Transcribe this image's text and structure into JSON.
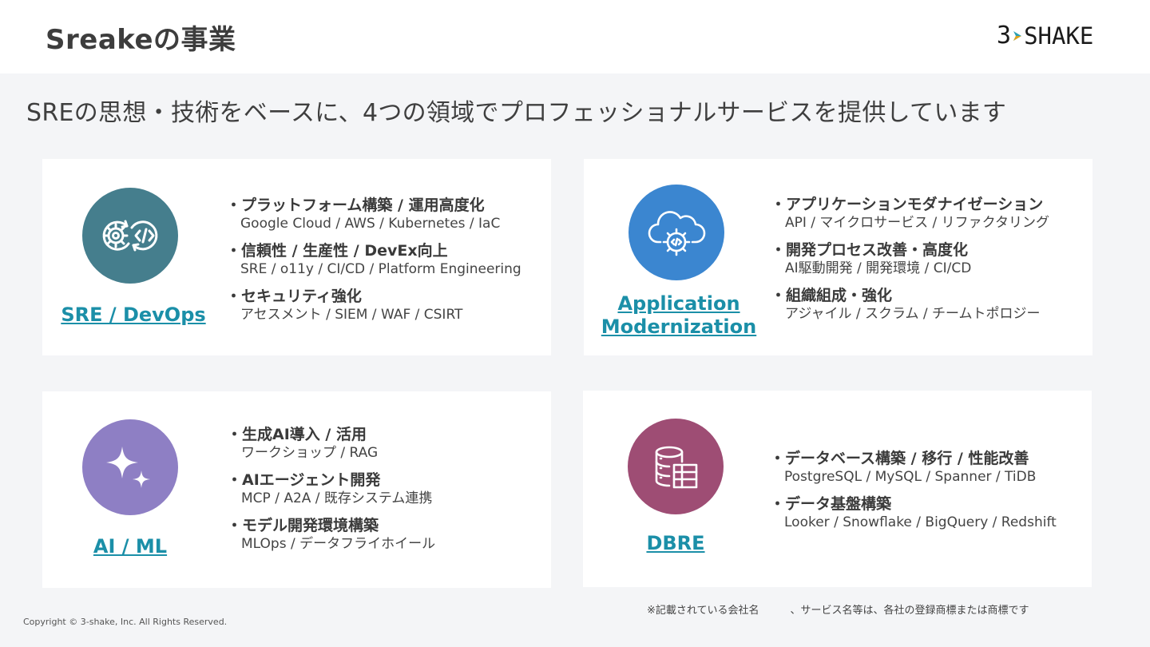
{
  "header": {
    "title": "Sreakeの事業",
    "logo_num": "3",
    "logo_text": "SHAKE"
  },
  "subtitle": "SREの思想・技術をベースに、4つの領域でプロフェッショナルサービスを提供しています",
  "colors": {
    "sre": "#457e8d",
    "app": "#3b86d0",
    "ai": "#8e7fc4",
    "dbre": "#9e4d74",
    "link": "#1b8fa8"
  },
  "cards": {
    "sre": {
      "name": "SRE / DevOps",
      "icon": "gear-code-cycle-icon",
      "bullets": [
        {
          "title": "・プラットフォーム構築 / 運用高度化",
          "sub": "Google Cloud / AWS / Kubernetes / IaC"
        },
        {
          "title": "・信頼性 / 生産性 / DevEx向上",
          "sub": "SRE / o11y / CI/CD / Platform Engineering"
        },
        {
          "title": "・セキュリティ強化",
          "sub": "アセスメント / SIEM / WAF / CSIRT"
        }
      ]
    },
    "app": {
      "name_line1": "Application",
      "name_line2": "Modernization",
      "icon": "cloud-gear-icon",
      "bullets": [
        {
          "title": "・アプリケーションモダナイゼーション",
          "sub": "API / マイクロサービス / リファクタリング"
        },
        {
          "title": "・開発プロセス改善・高度化",
          "sub": "AI駆動開発 / 開発環境 / CI/CD"
        },
        {
          "title": "・組織組成・強化",
          "sub": "アジャイル / スクラム / チームトポロジー"
        }
      ]
    },
    "ai": {
      "name": "AI / ML",
      "icon": "sparkle-icon",
      "bullets": [
        {
          "title": "・生成AI導入 / 活用",
          "sub": "ワークショップ / RAG"
        },
        {
          "title": "・AIエージェント開発",
          "sub": "MCP / A2A / 既存システム連携"
        },
        {
          "title": "・モデル開発環境構築",
          "sub": "MLOps / データフライホイール"
        }
      ]
    },
    "dbre": {
      "name": "DBRE",
      "icon": "database-table-icon",
      "bullets": [
        {
          "title": "・データベース構築 / 移行 / 性能改善",
          "sub": "PostgreSQL / MySQL / Spanner / TiDB"
        },
        {
          "title": "・データ基盤構築",
          "sub": "Looker / Snowflake / BigQuery / Redshift"
        }
      ]
    }
  },
  "footer": {
    "copyright": "Copyright © 3-shake, Inc. All Rights Reserved.",
    "note": "※記載されている会社名　　　、サービス名等は、各社の登録商標または商標です"
  }
}
